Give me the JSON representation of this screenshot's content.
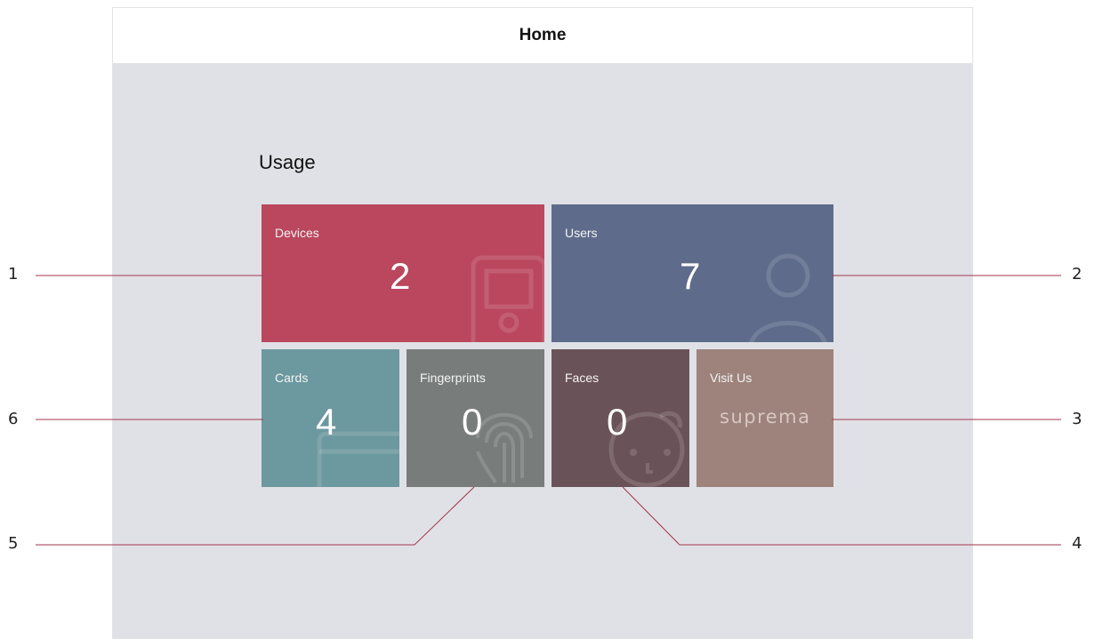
{
  "header": {
    "title": "Home"
  },
  "usage": {
    "title": "Usage",
    "tiles": {
      "devices": {
        "label": "Devices",
        "count": "2",
        "color": "#ba475e"
      },
      "users": {
        "label": "Users",
        "count": "7",
        "color": "#5e6b8b"
      },
      "cards": {
        "label": "Cards",
        "count": "4",
        "color": "#6c989f"
      },
      "fingerprints": {
        "label": "Fingerprints",
        "count": "0",
        "color": "#787d7c"
      },
      "faces": {
        "label": "Faces",
        "count": "0",
        "color": "#6a5358"
      },
      "visit": {
        "label": "Visit Us",
        "brand": "suprema",
        "color": "#9d837c"
      }
    }
  },
  "callouts": [
    "1",
    "2",
    "3",
    "4",
    "5",
    "6"
  ],
  "colors": {
    "callout_line": "#a3364c",
    "panel_bg": "#e0e1e6"
  }
}
